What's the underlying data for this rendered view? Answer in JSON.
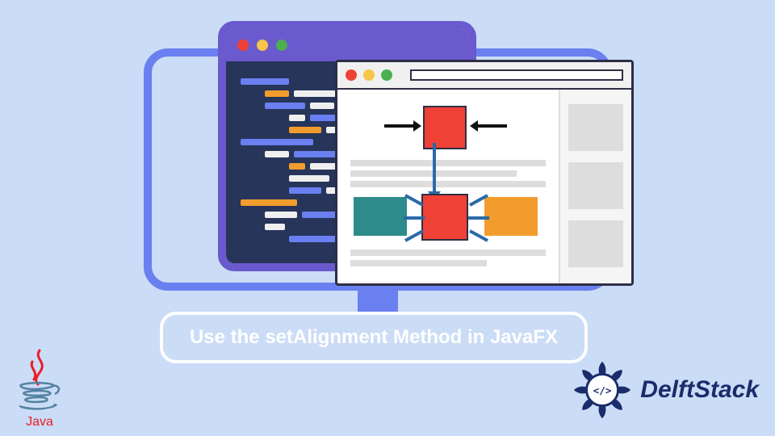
{
  "banner": {
    "title": "Use the setAlignment Method in JavaFX"
  },
  "java_logo_text": "Java",
  "delft_logo_text": "DelftStack",
  "colors": {
    "background": "#cbdcf6",
    "monitor": "#6a7ff0",
    "codewin_border": "#6a5acd",
    "code_bg": "#263559",
    "red": "#ef4135",
    "teal": "#2e8b8b",
    "orange": "#f39c2e",
    "delft_blue": "#1a2c6b"
  },
  "illustration": {
    "code_editor": {
      "traffic_lights": [
        "red",
        "yellow",
        "green"
      ],
      "lines": 16
    },
    "browser_mockup": {
      "traffic_lights": [
        "red",
        "yellow",
        "green"
      ],
      "top_alignment_demo": "center-horizontal-arrows-toward-red-square",
      "bottom_alignment_demo": "center-both-arrows-toward-red-square-between-teal-and-orange"
    }
  }
}
